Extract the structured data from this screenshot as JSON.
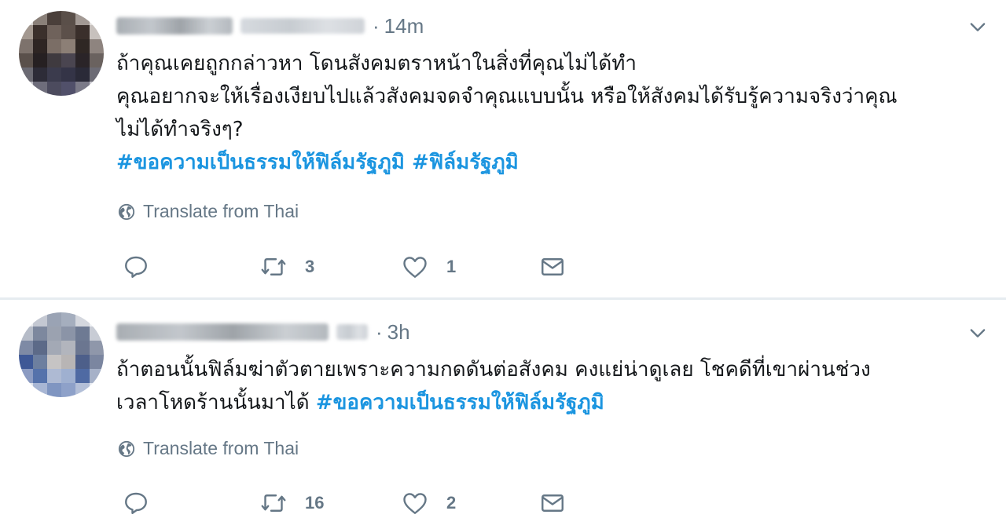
{
  "tweets": [
    {
      "time": "14m",
      "lines": [
        "ถ้าคุณเคยถูกกล่าวหา โดนสังคมตราหน้าในสิ่งที่คุณไม่ได้ทำ",
        "คุณอยากจะให้เรื่องเงียบไปแล้วสังคมจดจำคุณแบบนั้น หรือให้สังคมได้รับรู้ความจริงว่าคุณ",
        "ไม่ได้ทำจริงๆ?"
      ],
      "hashtags": "#ขอความเป็นธรรมให้ฟิล์มรัฐภูมิ #ฟิล์มรัฐภูมิ",
      "translate_label": "Translate from Thai",
      "retweets": "3",
      "likes": "1"
    },
    {
      "time": "3h",
      "lines": [
        "ถ้าตอนนั้นฟิล์มฆ่าตัวตายเพราะความกดดันต่อสังคม คงแย่น่าดูเลย โชคดีที่เขาผ่านช่วง",
        "เวลาโหดร้านนั้นมาได้ "
      ],
      "hashtags": "#ขอความเป็นธรรมให้ฟิล์มรัฐภูมิ",
      "translate_label": "Translate from Thai",
      "retweets": "16",
      "likes": "2"
    }
  ],
  "icons": {
    "reply": "reply-icon",
    "retweet": "retweet-icon",
    "like": "heart-icon",
    "message": "envelope-icon",
    "globe": "globe-icon",
    "menu": "chevron-down-icon"
  },
  "colors": {
    "text": "#14171a",
    "muted": "#657786",
    "hashtag": "#1b95e0",
    "separator": "#e6ecf0"
  }
}
